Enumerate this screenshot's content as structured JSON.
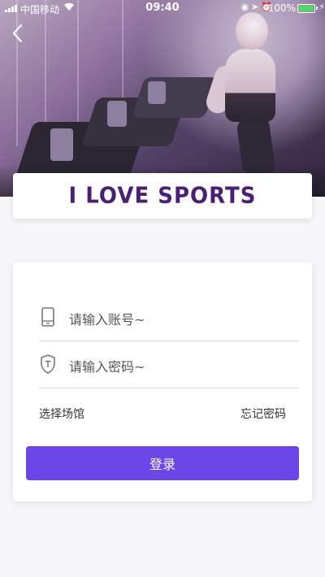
{
  "status_bar": {
    "carrier": "中国移动",
    "time": "09:40",
    "battery_percent": "100%",
    "battery_color": "#4cd964"
  },
  "nav": {
    "back_icon": "chevron-left-icon"
  },
  "banner": {
    "title": "I LOVE SPORTS",
    "color": "#4b1f73"
  },
  "login": {
    "account_placeholder": "请输入账号~",
    "account_icon": "phone-icon",
    "password_placeholder": "请输入密码~",
    "password_icon": "shield-icon",
    "select_venue": "选择场馆",
    "forgot_password": "忘记密码",
    "submit_label": "登录",
    "accent_color": "#6c46e6"
  }
}
